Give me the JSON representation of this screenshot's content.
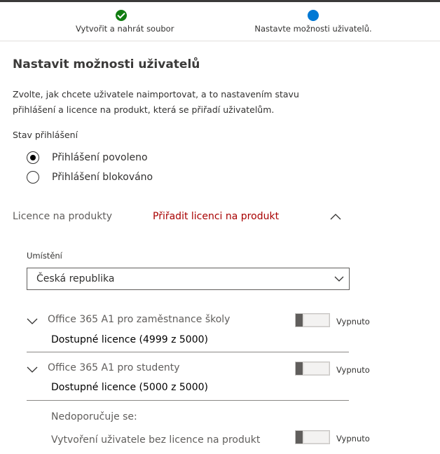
{
  "stepper": {
    "steps": [
      {
        "label": "Vytvořit a nahrát soubor",
        "state": "done"
      },
      {
        "label": "Nastavte možnosti uživatelů.",
        "state": "current"
      }
    ]
  },
  "page": {
    "title": "Nastavit možnosti uživatelů",
    "description": "Zvolte, jak chcete uživatele naimportovat, a to nastavením stavu přihlášení a licence na produkt, která se přiřadí uživatelům."
  },
  "signin": {
    "label": "Stav přihlášení",
    "options": [
      {
        "label": "Přihlášení povoleno",
        "selected": true
      },
      {
        "label": "Přihlášení blokováno",
        "selected": false
      }
    ]
  },
  "licenses": {
    "label": "Licence na produkty",
    "assign_link": "Přiřadit licenci na produkt",
    "location_label": "Umístění",
    "location_value": "Česká republika",
    "products": [
      {
        "name": "Office 365 A1 pro zaměstnance školy",
        "available": "Dostupné licence (4999 z 5000)",
        "toggle_label": "Vypnuto",
        "on": false
      },
      {
        "name": "Office 365 A1 pro studenty",
        "available": "Dostupné licence (5000 z 5000)",
        "toggle_label": "Vypnuto",
        "on": false
      }
    ],
    "not_recommended": "Nedoporučuje se:",
    "without_license": {
      "label": "Vytvoření uživatele bez licence na produkt",
      "toggle_label": "Vypnuto",
      "on": false
    }
  },
  "colors": {
    "done": "#107c10",
    "current": "#0078d4",
    "link": "#a80000"
  }
}
